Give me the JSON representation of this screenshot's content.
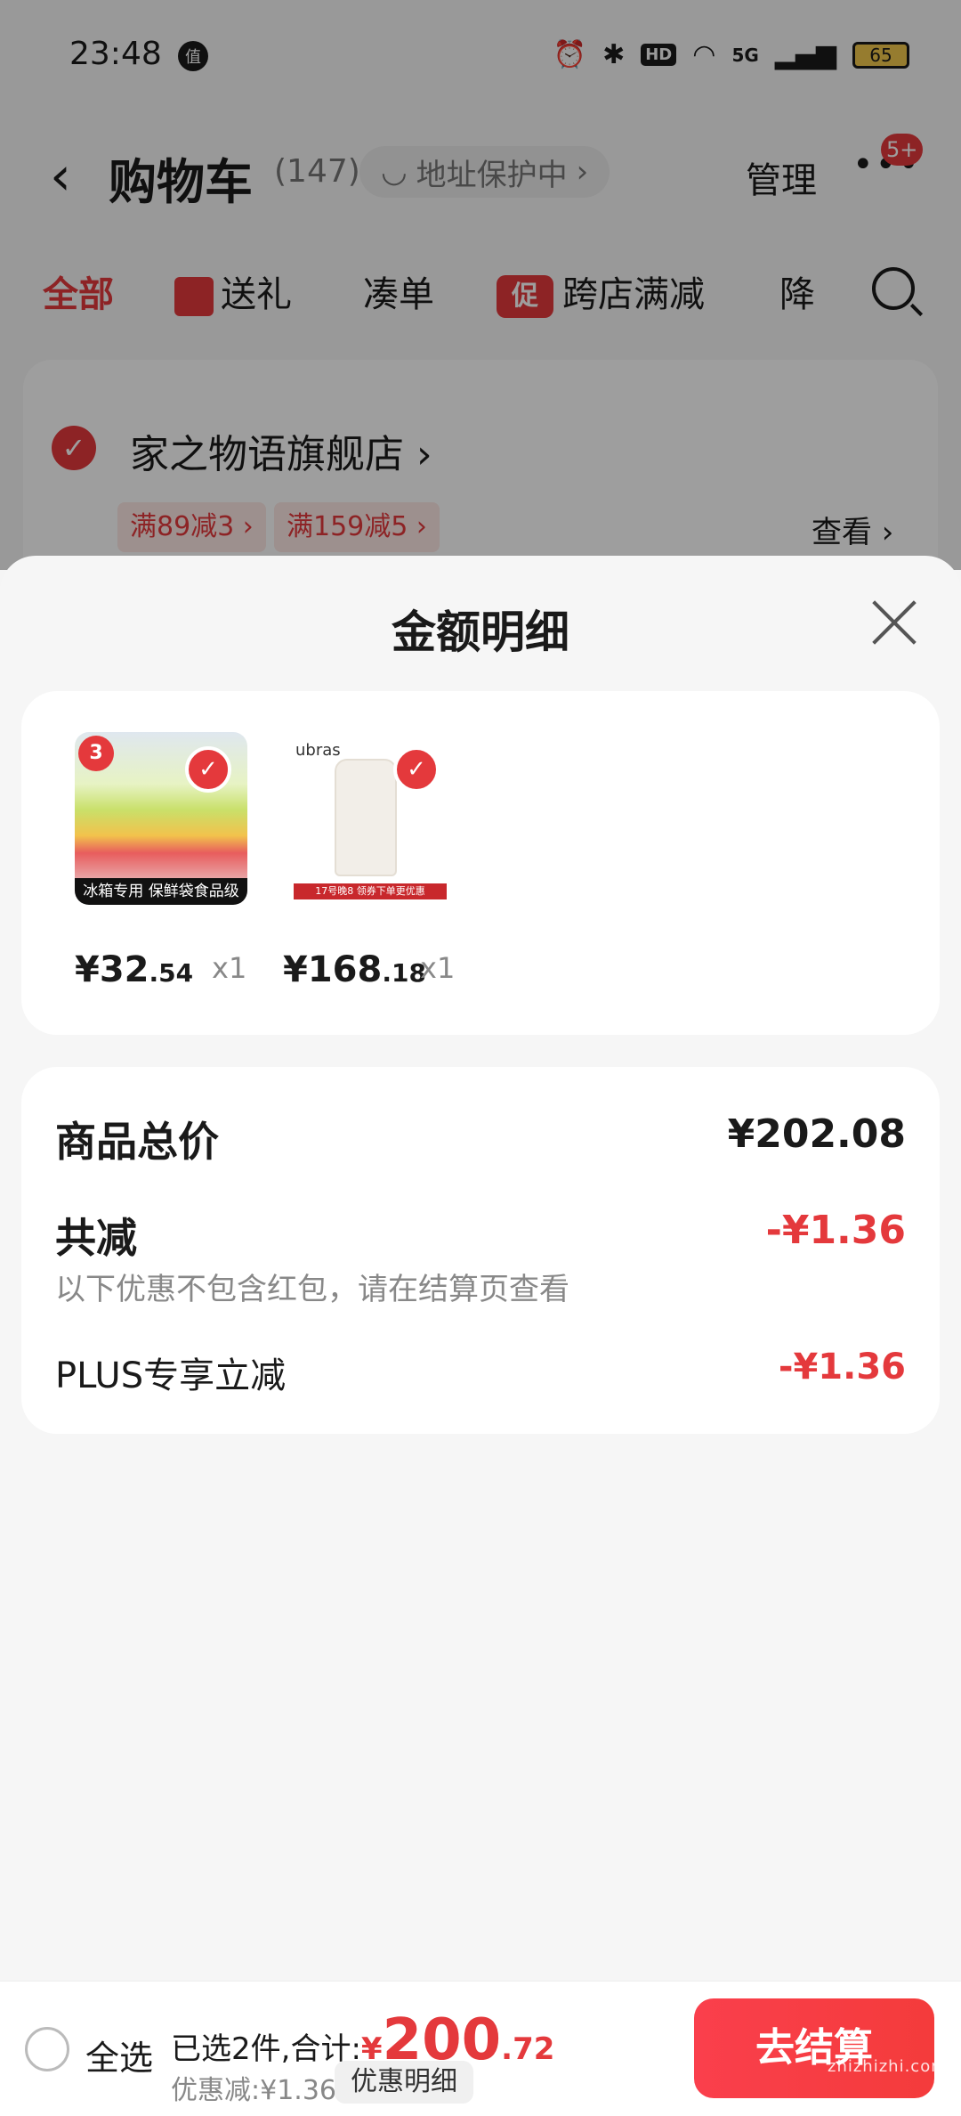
{
  "status_bar": {
    "time": "23:48",
    "notification_glyph": "值",
    "battery": "65",
    "network": "5G",
    "hd": "HD"
  },
  "header": {
    "title": "购物车",
    "count": "(147)",
    "address_protect": "地址保护中",
    "manage": "管理",
    "badge": "5+"
  },
  "tabs": {
    "all": "全部",
    "gift": "送礼",
    "combine": "凑单",
    "promo_glyph": "促",
    "cross_store": "跨店满减",
    "price_drop": "降"
  },
  "store": {
    "name": "家之物语旗舰店",
    "coupons": [
      "满89减3",
      "满159减5"
    ],
    "view": "查看"
  },
  "sheet": {
    "title": "金额明细",
    "products": [
      {
        "thumb_caption": "冰箱专用 保鲜袋食品级",
        "thumb_tag": "3",
        "price_int": "¥32",
        "price_dec": ".54",
        "qty": "x1"
      },
      {
        "thumb_brand": "ubras",
        "thumb_strip": "17号晚8 领券下单更优惠",
        "price_int": "¥168",
        "price_dec": ".18",
        "qty": "x1"
      }
    ],
    "summary": {
      "total_label": "商品总价",
      "total_value": "¥202.08",
      "discount_label": "共减",
      "discount_value": "-¥1.36",
      "discount_note": "以下优惠不包含红包，请在结算页查看",
      "plus_label": "PLUS专享立减",
      "plus_value": "-¥1.36"
    }
  },
  "bottom": {
    "select_all": "全选",
    "selected_text": "已选2件,合计:",
    "yen": "¥",
    "amount_int": "200",
    "amount_dec": ".72",
    "discount_text": "优惠减:¥1.36",
    "detail_button": "优惠明细",
    "checkout": "去结算",
    "watermark": "zhizhizhi.com"
  },
  "colors": {
    "accent": "#e4393c",
    "sheet_bg": "#f6f6f6"
  }
}
